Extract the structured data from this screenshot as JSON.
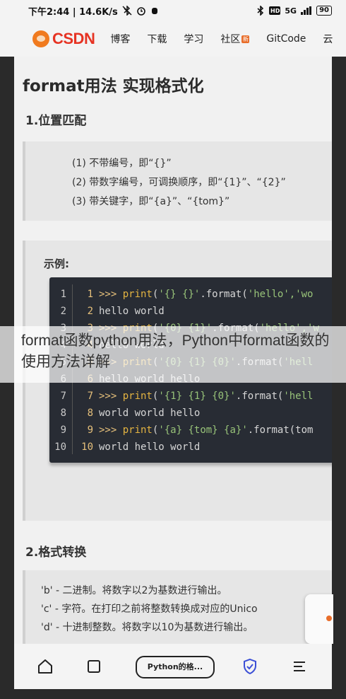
{
  "status_bar": {
    "time_speed": "下午2:44 | 14.6K/s",
    "network": "5G",
    "battery": "90"
  },
  "nav": {
    "logo": "CSDN",
    "items": [
      "博客",
      "下载",
      "学习",
      "社区",
      "GitCode",
      "云"
    ],
    "badge": "新"
  },
  "article": {
    "title": "format用法 实现格式化",
    "section1": "1.位置匹配",
    "quote_lines": [
      "(1) 不带编号，即“{}”",
      "(2) 带数字编号，可调换顺序，即“{1}”、“{2}”",
      "(3) 带关键字，即“{a}”、“{tom}”"
    ],
    "example_label": "示例:",
    "section2": "2.格式转换",
    "conversion_lines": [
      "'b' - 二进制。将数字以2为基数进行输出。",
      "'c' - 字符。在打印之前将整数转换成对应的Unico",
      "'d' - 十进制整数。将数字以10为基数进行输出。"
    ]
  },
  "code": {
    "lines": [
      {
        "n": "1",
        "m": "1",
        "prompt": ">>> ",
        "kw": "print",
        "a": "(",
        "s1": "'{} {}'",
        "b": ".format(",
        "s2": "'hello','wo",
        "out": ""
      },
      {
        "n": "2",
        "m": "2",
        "prompt": "",
        "kw": "",
        "a": "",
        "s1": "",
        "b": "",
        "s2": "",
        "out": "hello world"
      },
      {
        "n": "3",
        "m": "3",
        "prompt": ">>> ",
        "kw": "print",
        "a": "(",
        "s1": "'{0} {1}'",
        "b": ".format(",
        "s2": "'hello','w",
        "out": ""
      },
      {
        "n": "4",
        "m": "4",
        "prompt": "",
        "kw": "",
        "a": "",
        "s1": "",
        "b": "",
        "s2": "",
        "out": "hello world"
      },
      {
        "n": "5",
        "m": "5",
        "prompt": ">>> ",
        "kw": "print",
        "a": "(",
        "s1": "'{0} {1} {0}'",
        "b": ".format(",
        "s2": "'hell",
        "out": ""
      },
      {
        "n": "6",
        "m": "6",
        "prompt": "",
        "kw": "",
        "a": "",
        "s1": "",
        "b": "",
        "s2": "",
        "out": "hello world hello"
      },
      {
        "n": "7",
        "m": "7",
        "prompt": ">>> ",
        "kw": "print",
        "a": "(",
        "s1": "'{1} {1} {0}'",
        "b": ".format(",
        "s2": "'hell",
        "out": ""
      },
      {
        "n": "8",
        "m": "8",
        "prompt": "",
        "kw": "",
        "a": "",
        "s1": "",
        "b": "",
        "s2": "",
        "out": "world world hello"
      },
      {
        "n": "9",
        "m": "9",
        "prompt": ">>> ",
        "kw": "print",
        "a": "(",
        "s1": "'{a} {tom} {a}'",
        "b": ".format(tom",
        "s2": "",
        "out": ""
      },
      {
        "n": "10",
        "m": "10",
        "prompt": "",
        "kw": "",
        "a": "",
        "s1": "",
        "b": "",
        "s2": "",
        "out": "world hello world"
      }
    ]
  },
  "overlay": {
    "caption": "format函数python用法，Python中format函数的使用方法详解"
  },
  "bottom_bar": {
    "tab_label": "Python的格..."
  },
  "colors": {
    "csdn_red": "#e63323",
    "code_bg": "#282c34",
    "keyword": "#e3b341",
    "string": "#98c379",
    "shield_blue": "#3b4fd6"
  }
}
